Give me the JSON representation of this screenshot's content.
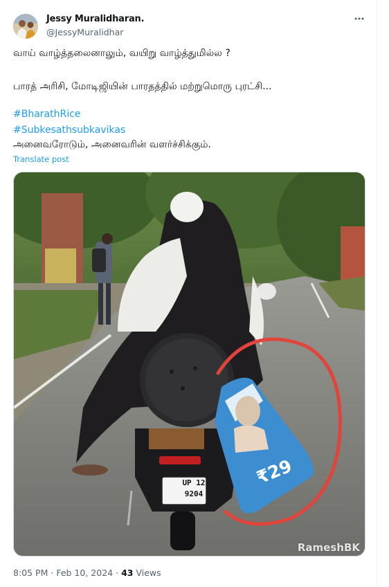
{
  "tweet": {
    "author": {
      "display_name": "Jessy Muralidharan.",
      "handle": "@JessyMuralidhar"
    },
    "more_icon": "more-horizontal-icon",
    "lines": [
      "வாய் வாழ்த்தலைனாலும், வயிறு வாழ்த்துமில்ல ?",
      "பாரத் அரிசி, மோடிஜியின் பாரதத்தில் மற்றுமொரு புரட்சி..."
    ],
    "hashtags": [
      "#BharathRice",
      "#Subkesathsubkavikas"
    ],
    "closing_line": "அனைவரோடும், அனைவரின் வளர்ச்சிக்கும்.",
    "translate_label": "Translate post",
    "media": {
      "bag_price": "₹29",
      "plate_line1": "UP 12",
      "plate_line2": "9204",
      "watermark": "RameshBK"
    },
    "meta": {
      "time": "8:05 PM",
      "separator": "·",
      "date": "Feb 10, 2024",
      "views_count": "43",
      "views_label": "Views"
    },
    "colors": {
      "text": "#0f1419",
      "secondary": "#536471",
      "link": "#1d9bf0",
      "annotation_circle": "#e0443a"
    }
  }
}
